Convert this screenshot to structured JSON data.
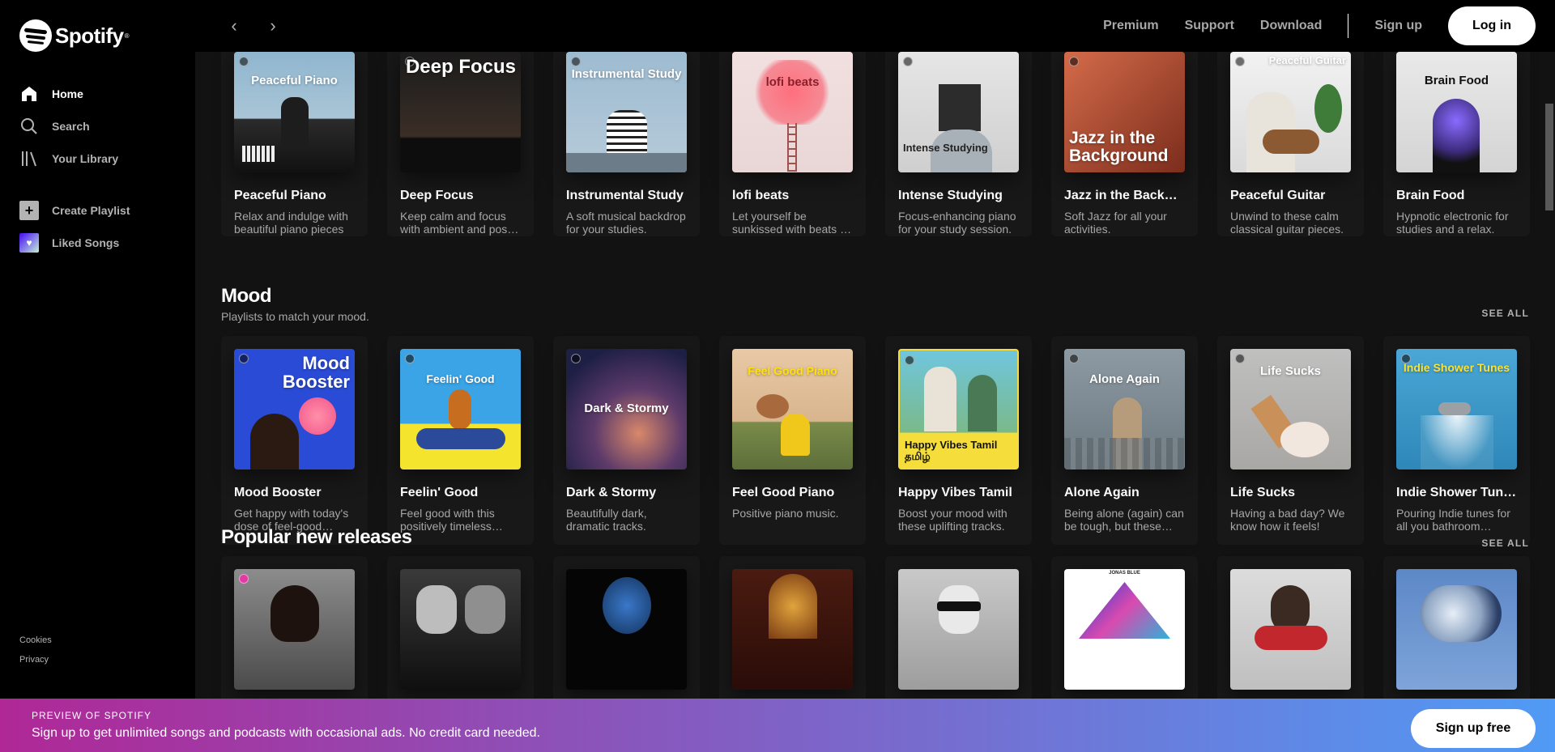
{
  "brand": {
    "name": "Spotify",
    "tm": "®"
  },
  "sidebar": {
    "items": [
      {
        "label": "Home",
        "icon": "home-icon"
      },
      {
        "label": "Search",
        "icon": "search-icon"
      },
      {
        "label": "Your Library",
        "icon": "library-icon"
      }
    ],
    "create_playlist": "Create Playlist",
    "liked_songs": "Liked Songs",
    "legal": [
      "Cookies",
      "Privacy"
    ]
  },
  "topbar": {
    "back": "‹",
    "forward": "›",
    "links": [
      "Premium",
      "Support",
      "Download"
    ],
    "signup": "Sign up",
    "login": "Log in"
  },
  "focus_row": [
    {
      "title": "Peaceful Piano",
      "desc": "Relax and indulge with beautiful piano pieces",
      "cover_text": "Peaceful Piano"
    },
    {
      "title": "Deep Focus",
      "desc": "Keep calm and focus with ambient and post-rock music.",
      "cover_text": "Deep Focus"
    },
    {
      "title": "Instrumental Study",
      "desc": "A soft musical backdrop for your studies.",
      "cover_text": "Instrumental Study"
    },
    {
      "title": "lofi beats",
      "desc": "Let yourself be sunkissed with beats to relax to.",
      "cover_text": "lofi beats"
    },
    {
      "title": "Intense Studying",
      "desc": "Focus-enhancing piano for your study session.",
      "cover_text": "Intense Studying"
    },
    {
      "title": "Jazz in the Background",
      "desc": "Soft Jazz for all your activities.",
      "cover_text": "Jazz in the Background"
    },
    {
      "title": "Peaceful Guitar",
      "desc": "Unwind to these calm classical guitar pieces.",
      "cover_text": "Peaceful Guitar"
    },
    {
      "title": "Brain Food",
      "desc": "Hypnotic electronic for studies and a relax.",
      "cover_text": "Brain Food"
    }
  ],
  "mood": {
    "title": "Mood",
    "subtitle": "Playlists to match your mood.",
    "see_all": "SEE ALL",
    "items": [
      {
        "title": "Mood Booster",
        "desc": "Get happy with today's dose of feel-good songs!",
        "cover_text": "Mood Booster"
      },
      {
        "title": "Feelin' Good",
        "desc": "Feel good with this positively timeless playlist!",
        "cover_text": "Feelin' Good"
      },
      {
        "title": "Dark & Stormy",
        "desc": "Beautifully dark, dramatic tracks.",
        "cover_text": "Dark & Stormy"
      },
      {
        "title": "Feel Good Piano",
        "desc": "Positive piano music.",
        "cover_text": "Feel Good Piano"
      },
      {
        "title": "Happy Vibes Tamil",
        "desc": "Boost your mood with these uplifting tracks.",
        "cover_text": "Happy Vibes Tamil தமிழ்"
      },
      {
        "title": "Alone Again",
        "desc": "Being alone (again) can be tough, but these songs can help.",
        "cover_text": "Alone Again"
      },
      {
        "title": "Life Sucks",
        "desc": "Having a bad day? We know how it feels!",
        "cover_text": "Life Sucks"
      },
      {
        "title": "Indie Shower Tunes",
        "desc": "Pouring Indie tunes for all you bathroom singers.",
        "cover_text": "Indie Shower Tunes"
      }
    ]
  },
  "releases": {
    "title": "Popular new releases",
    "see_all": "SEE ALL",
    "cover_small_text": [
      "",
      "",
      "",
      "",
      "",
      "JONAS BLUE",
      "",
      ""
    ]
  },
  "banner": {
    "kicker": "Preview of Spotify",
    "text": "Sign up to get unlimited songs and podcasts with occasional ads. No credit card needed.",
    "button": "Sign up free"
  },
  "colors": {
    "bg": "#121212",
    "sidebar": "#000000",
    "card": "#181818",
    "muted": "#a7a7a7",
    "banner_start": "#af2896",
    "banner_end": "#509bf5"
  }
}
